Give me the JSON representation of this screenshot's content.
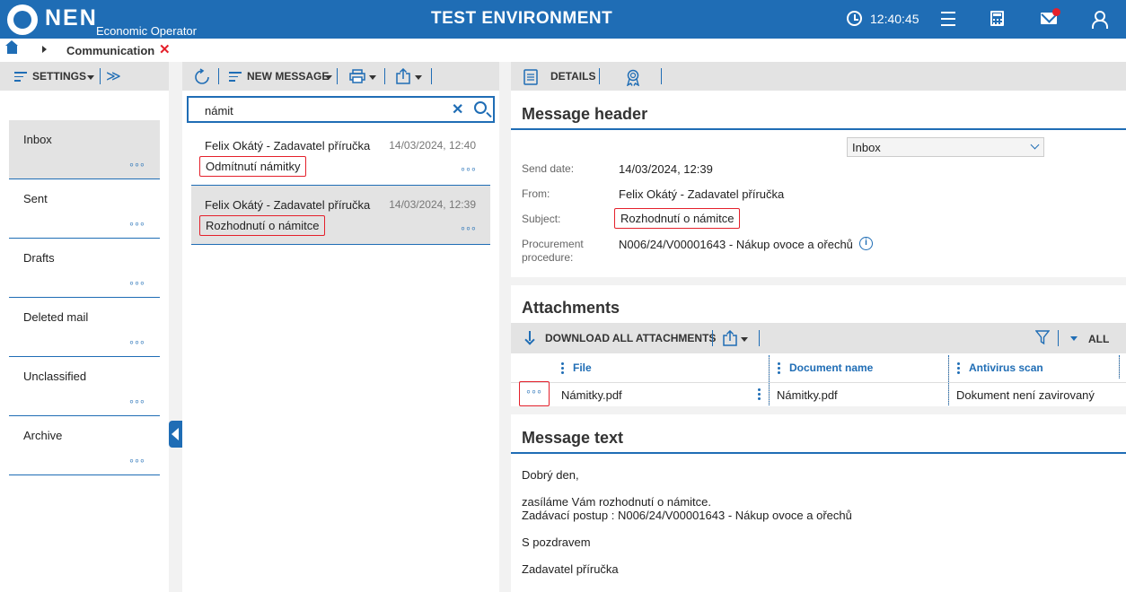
{
  "topbar": {
    "brand": "NEN",
    "brand_sub": "Economic Operator",
    "environment": "TEST ENVIRONMENT",
    "clock": "12:40:45"
  },
  "breadcrumb": {
    "current": "Communication",
    "close_symbol": "✕"
  },
  "folders_toolbar": {
    "settings_label": "SETTINGS",
    "expand_symbol": "≫"
  },
  "folders": [
    {
      "name": "Inbox",
      "more": "◦◦◦"
    },
    {
      "name": "Sent",
      "more": "◦◦◦"
    },
    {
      "name": "Drafts",
      "more": "◦◦◦"
    },
    {
      "name": "Deleted mail",
      "more": "◦◦◦"
    },
    {
      "name": "Unclassified",
      "more": "◦◦◦"
    },
    {
      "name": "Archive",
      "more": "◦◦◦"
    }
  ],
  "messages_toolbar": {
    "new_message_label": "NEW MESSAGE"
  },
  "search": {
    "value": "námit",
    "clear_symbol": "✕"
  },
  "messages": [
    {
      "from": "Felix Okátý - Zadavatel příručka",
      "date": "14/03/2024, 12:40",
      "subject": "Odmítnutí námitky",
      "more": "◦◦◦"
    },
    {
      "from": "Felix Okátý - Zadavatel příručka",
      "date": "14/03/2024, 12:39",
      "subject": "Rozhodnutí o námitce",
      "more": "◦◦◦"
    }
  ],
  "detail_toolbar": {
    "details_label": "DETAILS"
  },
  "message_header": {
    "title": "Message header",
    "folder_select": "Inbox",
    "send_date_label": "Send date:",
    "send_date": "14/03/2024, 12:39",
    "from_label": "From:",
    "from": "Felix Okátý - Zadavatel příručka",
    "subject_label": "Subject:",
    "subject": "Rozhodnutí o námitce",
    "procedure_label_1": "Procurement",
    "procedure_label_2": "procedure:",
    "procedure": "N006/24/V00001643 - Nákup ovoce a ořechů",
    "info_symbol": "i"
  },
  "attachments": {
    "title": "Attachments",
    "download_all_label": "DOWNLOAD ALL ATTACHMENTS",
    "all_label": "ALL",
    "columns": [
      "File",
      "Document name",
      "Antivirus scan"
    ],
    "rows": [
      {
        "more": "◦◦◦",
        "file": "Námitky.pdf",
        "document_name": "Námitky.pdf",
        "antivirus": "Dokument není zavirovaný"
      }
    ]
  },
  "message_text": {
    "title": "Message text",
    "lines": [
      "Dobrý den,",
      "zasíláme Vám rozhodnutí o námitce.",
      "Zadávací postup : N006/24/V00001643 - Nákup ovoce a ořechů",
      "S pozdravem",
      "Zadavatel příručka"
    ]
  },
  "colors": {
    "brand_blue": "#1f6db5",
    "highlight_red": "#e4202b",
    "toolbar_gray": "#e3e3e3"
  }
}
